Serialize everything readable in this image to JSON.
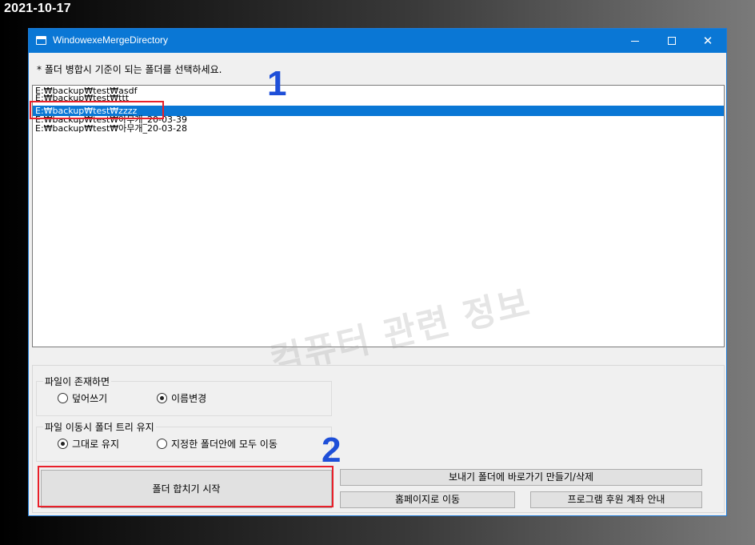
{
  "date_stamp": "2021-10-17",
  "window": {
    "title": "WindowexeMergeDirectory",
    "controls": {
      "minimize": "—",
      "maximize": "☐",
      "close": "✕"
    }
  },
  "instruction": "* 폴더 병합시 기준이 되는 폴더를 선택하세요.",
  "folders": [
    "E:₩backup₩test₩asdf",
    "E:₩backup₩test₩ttt",
    "E:₩backup₩test₩zzzz",
    "E:₩backup₩test₩아무개_20-03-39",
    "E:₩backup₩test₩아무개_20-03-28"
  ],
  "selected_folder_index": 2,
  "watermark": "컴퓨터 관련 정보",
  "annotations": {
    "first": "1",
    "second": "2",
    "color": "#e8202a",
    "number_color": "#1e4fd8"
  },
  "file_exists_group": {
    "title": "파일이 존재하면",
    "options": [
      "덮어쓰기",
      "이름변경"
    ],
    "selected": "이름변경"
  },
  "tree_group": {
    "title": "파일 이동시 폴더 트리 유지",
    "options": [
      "그대로 유지",
      "지정한 폴더안에 모두 이동"
    ],
    "selected": "그대로 유지"
  },
  "buttons": {
    "merge_start": "폴더 합치기 시작",
    "sendto_shortcut": "보내기 폴더에 바로가기 만들기/삭제",
    "homepage": "홈페이지로 이동",
    "donation": "프로그램 후원 계좌 안내"
  },
  "colors": {
    "titlebar": "#0a77d5",
    "selection": "#0a77d5"
  }
}
